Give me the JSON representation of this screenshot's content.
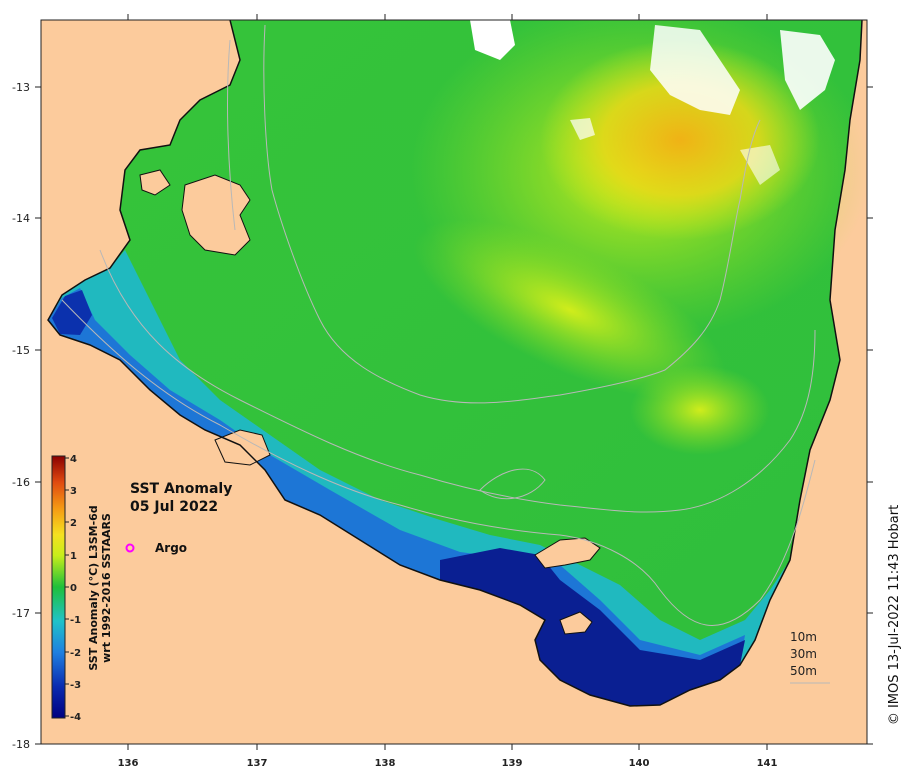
{
  "map": {
    "title_line1": "SST Anomaly",
    "title_line2": "05 Jul 2022",
    "marker_legend_label": "Argo",
    "credit": "© IMOS 13-Jul-2022 11:43 Hobart",
    "x_ticks": [
      "136",
      "137",
      "138",
      "139",
      "140",
      "141"
    ],
    "y_ticks": [
      "-13",
      "-14",
      "-15",
      "-16",
      "-17",
      "-18"
    ],
    "lon_range": [
      135.3,
      141.8
    ],
    "lat_range": [
      -18.0,
      -12.5
    ],
    "contours": [
      "10m",
      "30m",
      "50m"
    ]
  },
  "colorbar": {
    "title_line1": "SST Anomaly (°C) L3SM-6d",
    "title_line2": "wrt 1992-2016 SSTAARS",
    "ticks": [
      "4",
      "3",
      "2",
      "1",
      "0",
      "-1",
      "-2",
      "-3",
      "-4"
    ],
    "range": [
      -4,
      4
    ]
  },
  "colors": {
    "land": "#fccb9c",
    "sea_cold": "#0a1b8a",
    "sea_cool": "#1fb7c8",
    "sea_neutral": "#22c13a",
    "sea_warm": "#d6ee1a",
    "sea_hot": "#f5b414",
    "argo_marker": "#ff00ff",
    "isobath": "#b8b8b8"
  }
}
